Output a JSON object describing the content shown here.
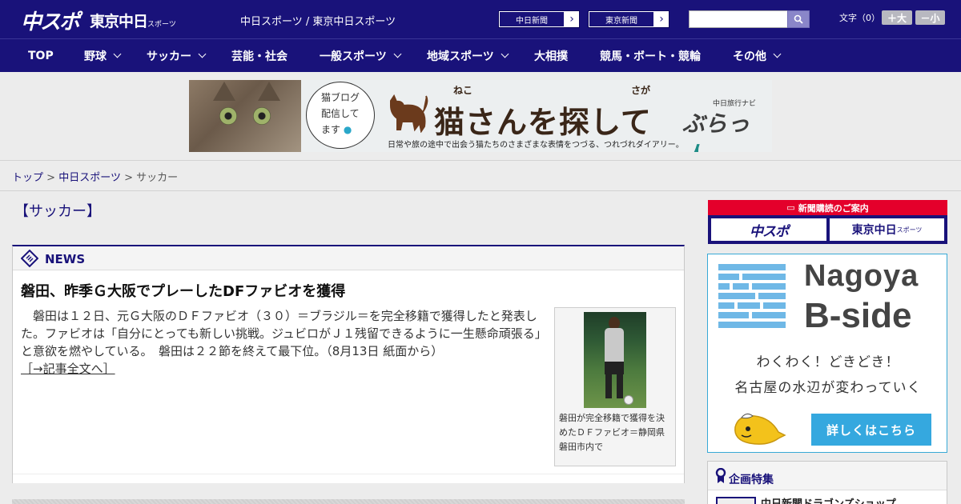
{
  "header": {
    "logo_chunichi": "中スポ",
    "logo_tokyo": "東京中日",
    "logo_tokyo_small": "スポーツ",
    "site_title": "中日スポーツ / 東京中日スポーツ",
    "paper_buttons": [
      {
        "label": "中日新聞"
      },
      {
        "label": "東京新聞"
      }
    ],
    "search": {
      "value": "",
      "placeholder": ""
    },
    "font_size_label": "文字（0）",
    "font_larger": "＋大",
    "font_smaller": "－小"
  },
  "nav": {
    "items": [
      {
        "label": "TOP",
        "has_submenu": false
      },
      {
        "label": "野球",
        "has_submenu": true
      },
      {
        "label": "サッカー",
        "has_submenu": true
      },
      {
        "label": "芸能・社会",
        "has_submenu": false
      },
      {
        "label": "一般スポーツ",
        "has_submenu": true
      },
      {
        "label": "地域スポーツ",
        "has_submenu": true
      },
      {
        "label": "大相撲",
        "has_submenu": false
      },
      {
        "label": "競馬・ボート・競輪",
        "has_submenu": false
      },
      {
        "label": "その他",
        "has_submenu": true
      }
    ]
  },
  "banner": {
    "speech": [
      "猫ブログ",
      "配信して",
      "ます"
    ],
    "title": "猫さんを探して",
    "ruby_1": "ねこ",
    "ruby_2": "さが",
    "subtitle": "日常や旅の途中で出会う猫たちのさまざまな表情をつづる、つれづれダイアリー。",
    "brand_small": "中日旅行ナビ",
    "brand": "ぶらっ",
    "brand_accent": "人"
  },
  "breadcrumb": {
    "items": [
      "トップ",
      "中日スポーツ",
      "サッカー"
    ],
    "separator": ">"
  },
  "main": {
    "page_title": "【サッカー】",
    "news_label": "NEWS",
    "article": {
      "title": "磐田、昨季Ｇ大阪でプレーしたDFファビオを獲得",
      "body": "磐田は１２日、元Ｇ大阪のＤＦファビオ（３０）＝ブラジル＝を完全移籍で獲得したと発表した。ファビオは「自分にとっても新しい挑戦。ジュビロがＪ１残留できるように一生懸命頑張る」と意欲を燃やしている。　磐田は２２節を終えて最下位。（8月13日 紙面から）",
      "more": "［→記事全文へ］",
      "photo_caption": "磐田が完全移籍で獲得を決めたＤＦファビオ＝静岡県磐田市内で"
    }
  },
  "sidebar": {
    "subscribe": {
      "head": "新聞購読のご案内",
      "btn1": "中スポ",
      "btn2": "東京中日",
      "btn2_small": "スポーツ"
    },
    "ad": {
      "title1": "Nagoya",
      "title2": "B-side",
      "catch1": "わくわく！どきどき！",
      "catch2": "名古屋の水辺が変わっていく",
      "button": "詳しくはこちら"
    },
    "feature": {
      "label": "企画特集",
      "item": "中日新聞ドラゴンズショップ"
    }
  },
  "colors": {
    "brand_navy": "#19127a",
    "accent_red": "#e4002b",
    "ad_blue": "#35a8df",
    "link": "#19127a"
  },
  "icons": {
    "search": "search-icon",
    "chevron": "chevron-down-icon",
    "news": "news-icon",
    "feature": "ribbon-icon",
    "paper_arrow": "chevron-right-icon"
  }
}
